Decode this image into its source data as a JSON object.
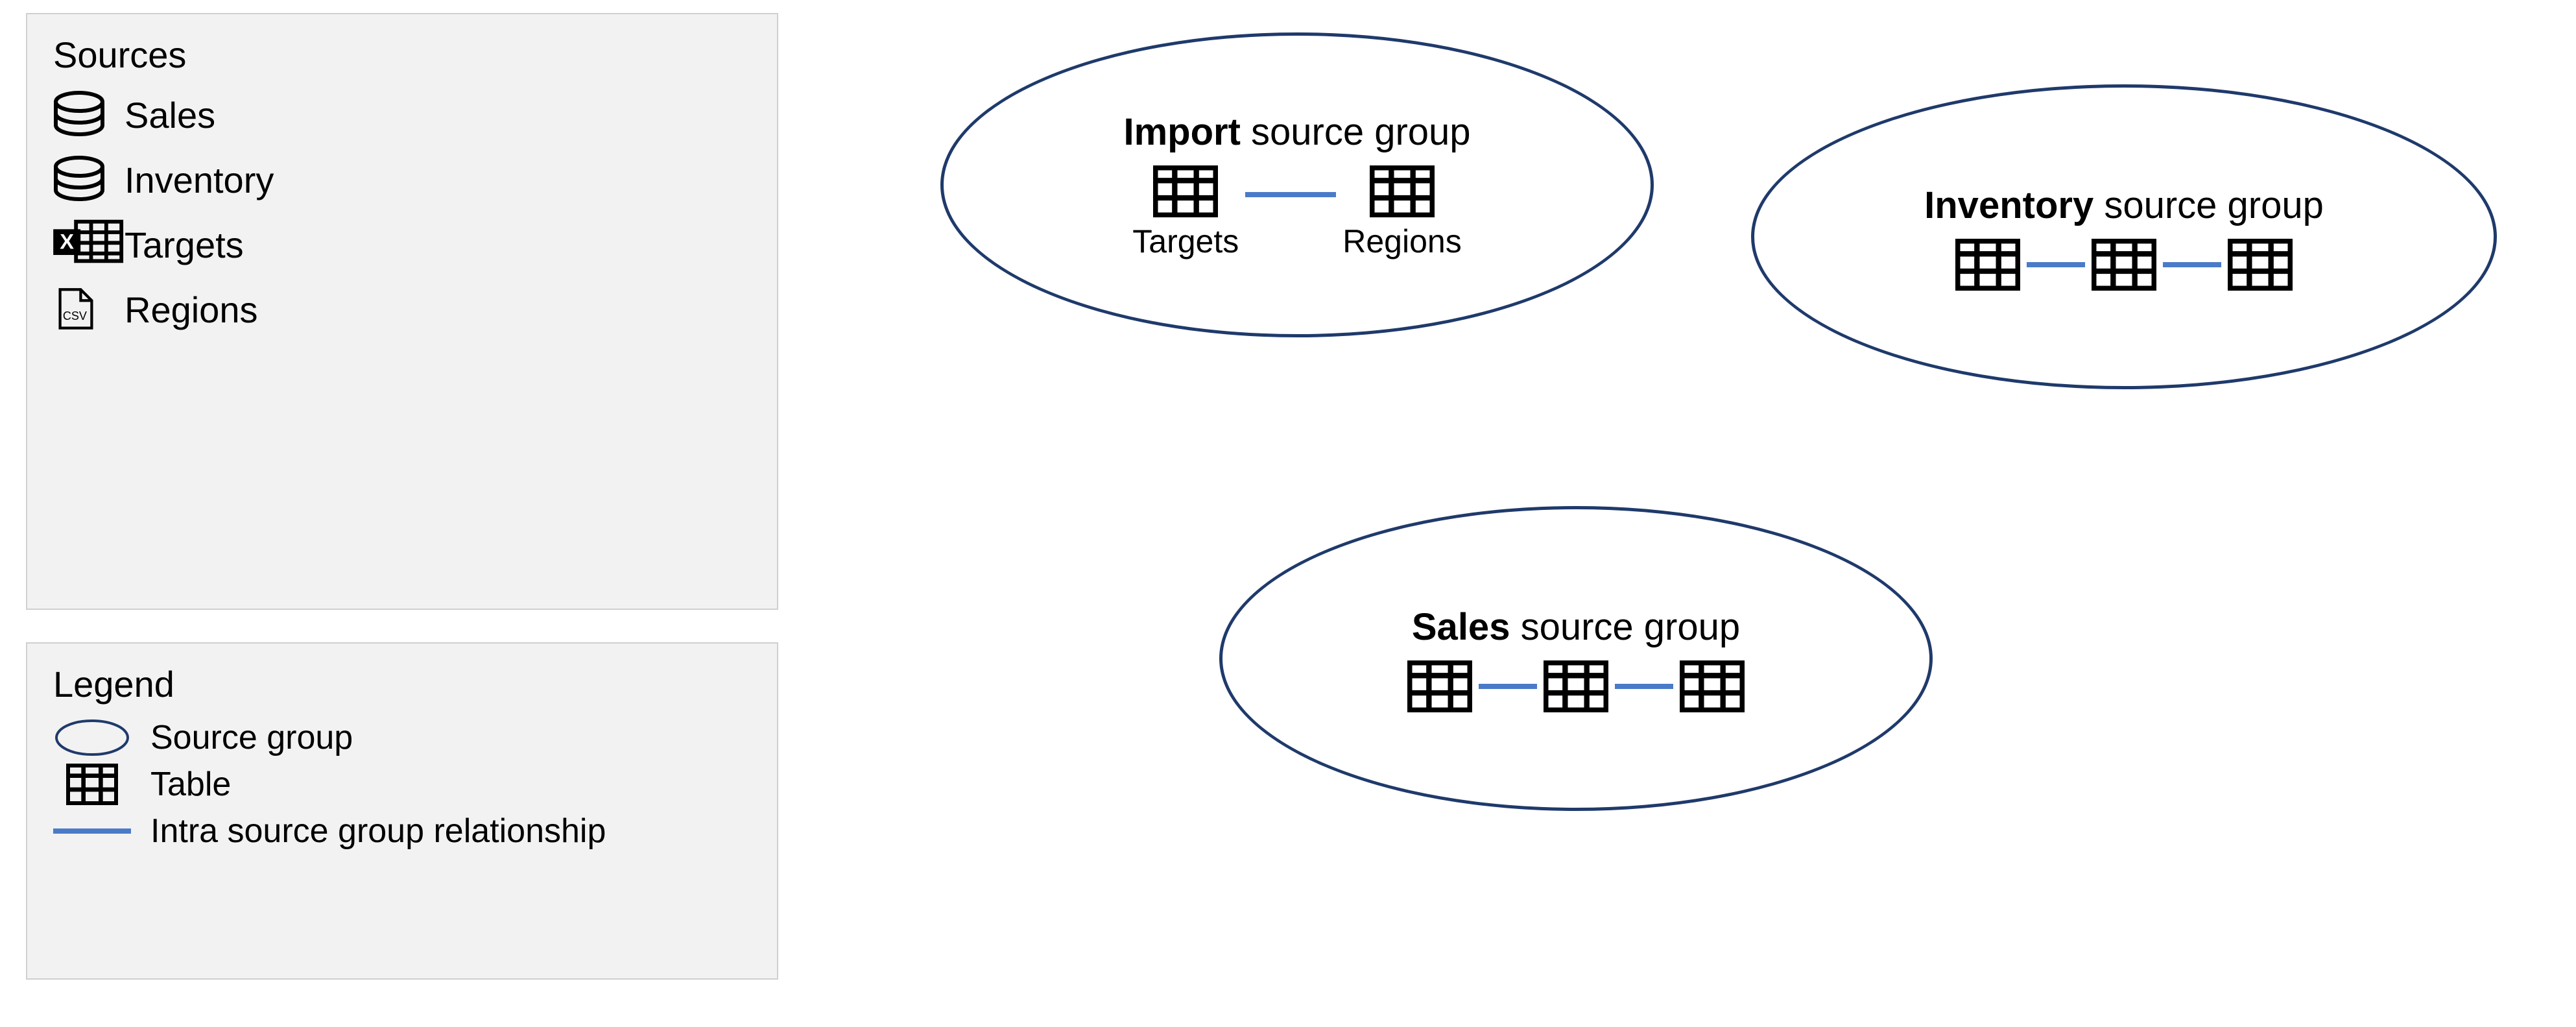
{
  "sources_panel": {
    "title": "Sources",
    "items": [
      {
        "label": "Sales",
        "icon": "database-icon"
      },
      {
        "label": "Inventory",
        "icon": "database-icon"
      },
      {
        "label": "Targets",
        "icon": "excel-icon"
      },
      {
        "label": "Regions",
        "icon": "csv-icon"
      }
    ]
  },
  "legend_panel": {
    "title": "Legend",
    "rows": [
      {
        "label": "Source group",
        "icon": "ellipse-icon"
      },
      {
        "label": "Table",
        "icon": "table-icon"
      },
      {
        "label": "Intra source group relationship",
        "icon": "line-icon"
      }
    ]
  },
  "groups": {
    "import": {
      "title_bold": "Import",
      "title_rest": " source group",
      "tables": [
        {
          "label": "Targets"
        },
        {
          "label": "Regions"
        }
      ]
    },
    "inventory": {
      "title_bold": "Inventory",
      "title_rest": " source group",
      "table_count": 3
    },
    "sales": {
      "title_bold": "Sales",
      "title_rest": " source group",
      "table_count": 3
    }
  }
}
